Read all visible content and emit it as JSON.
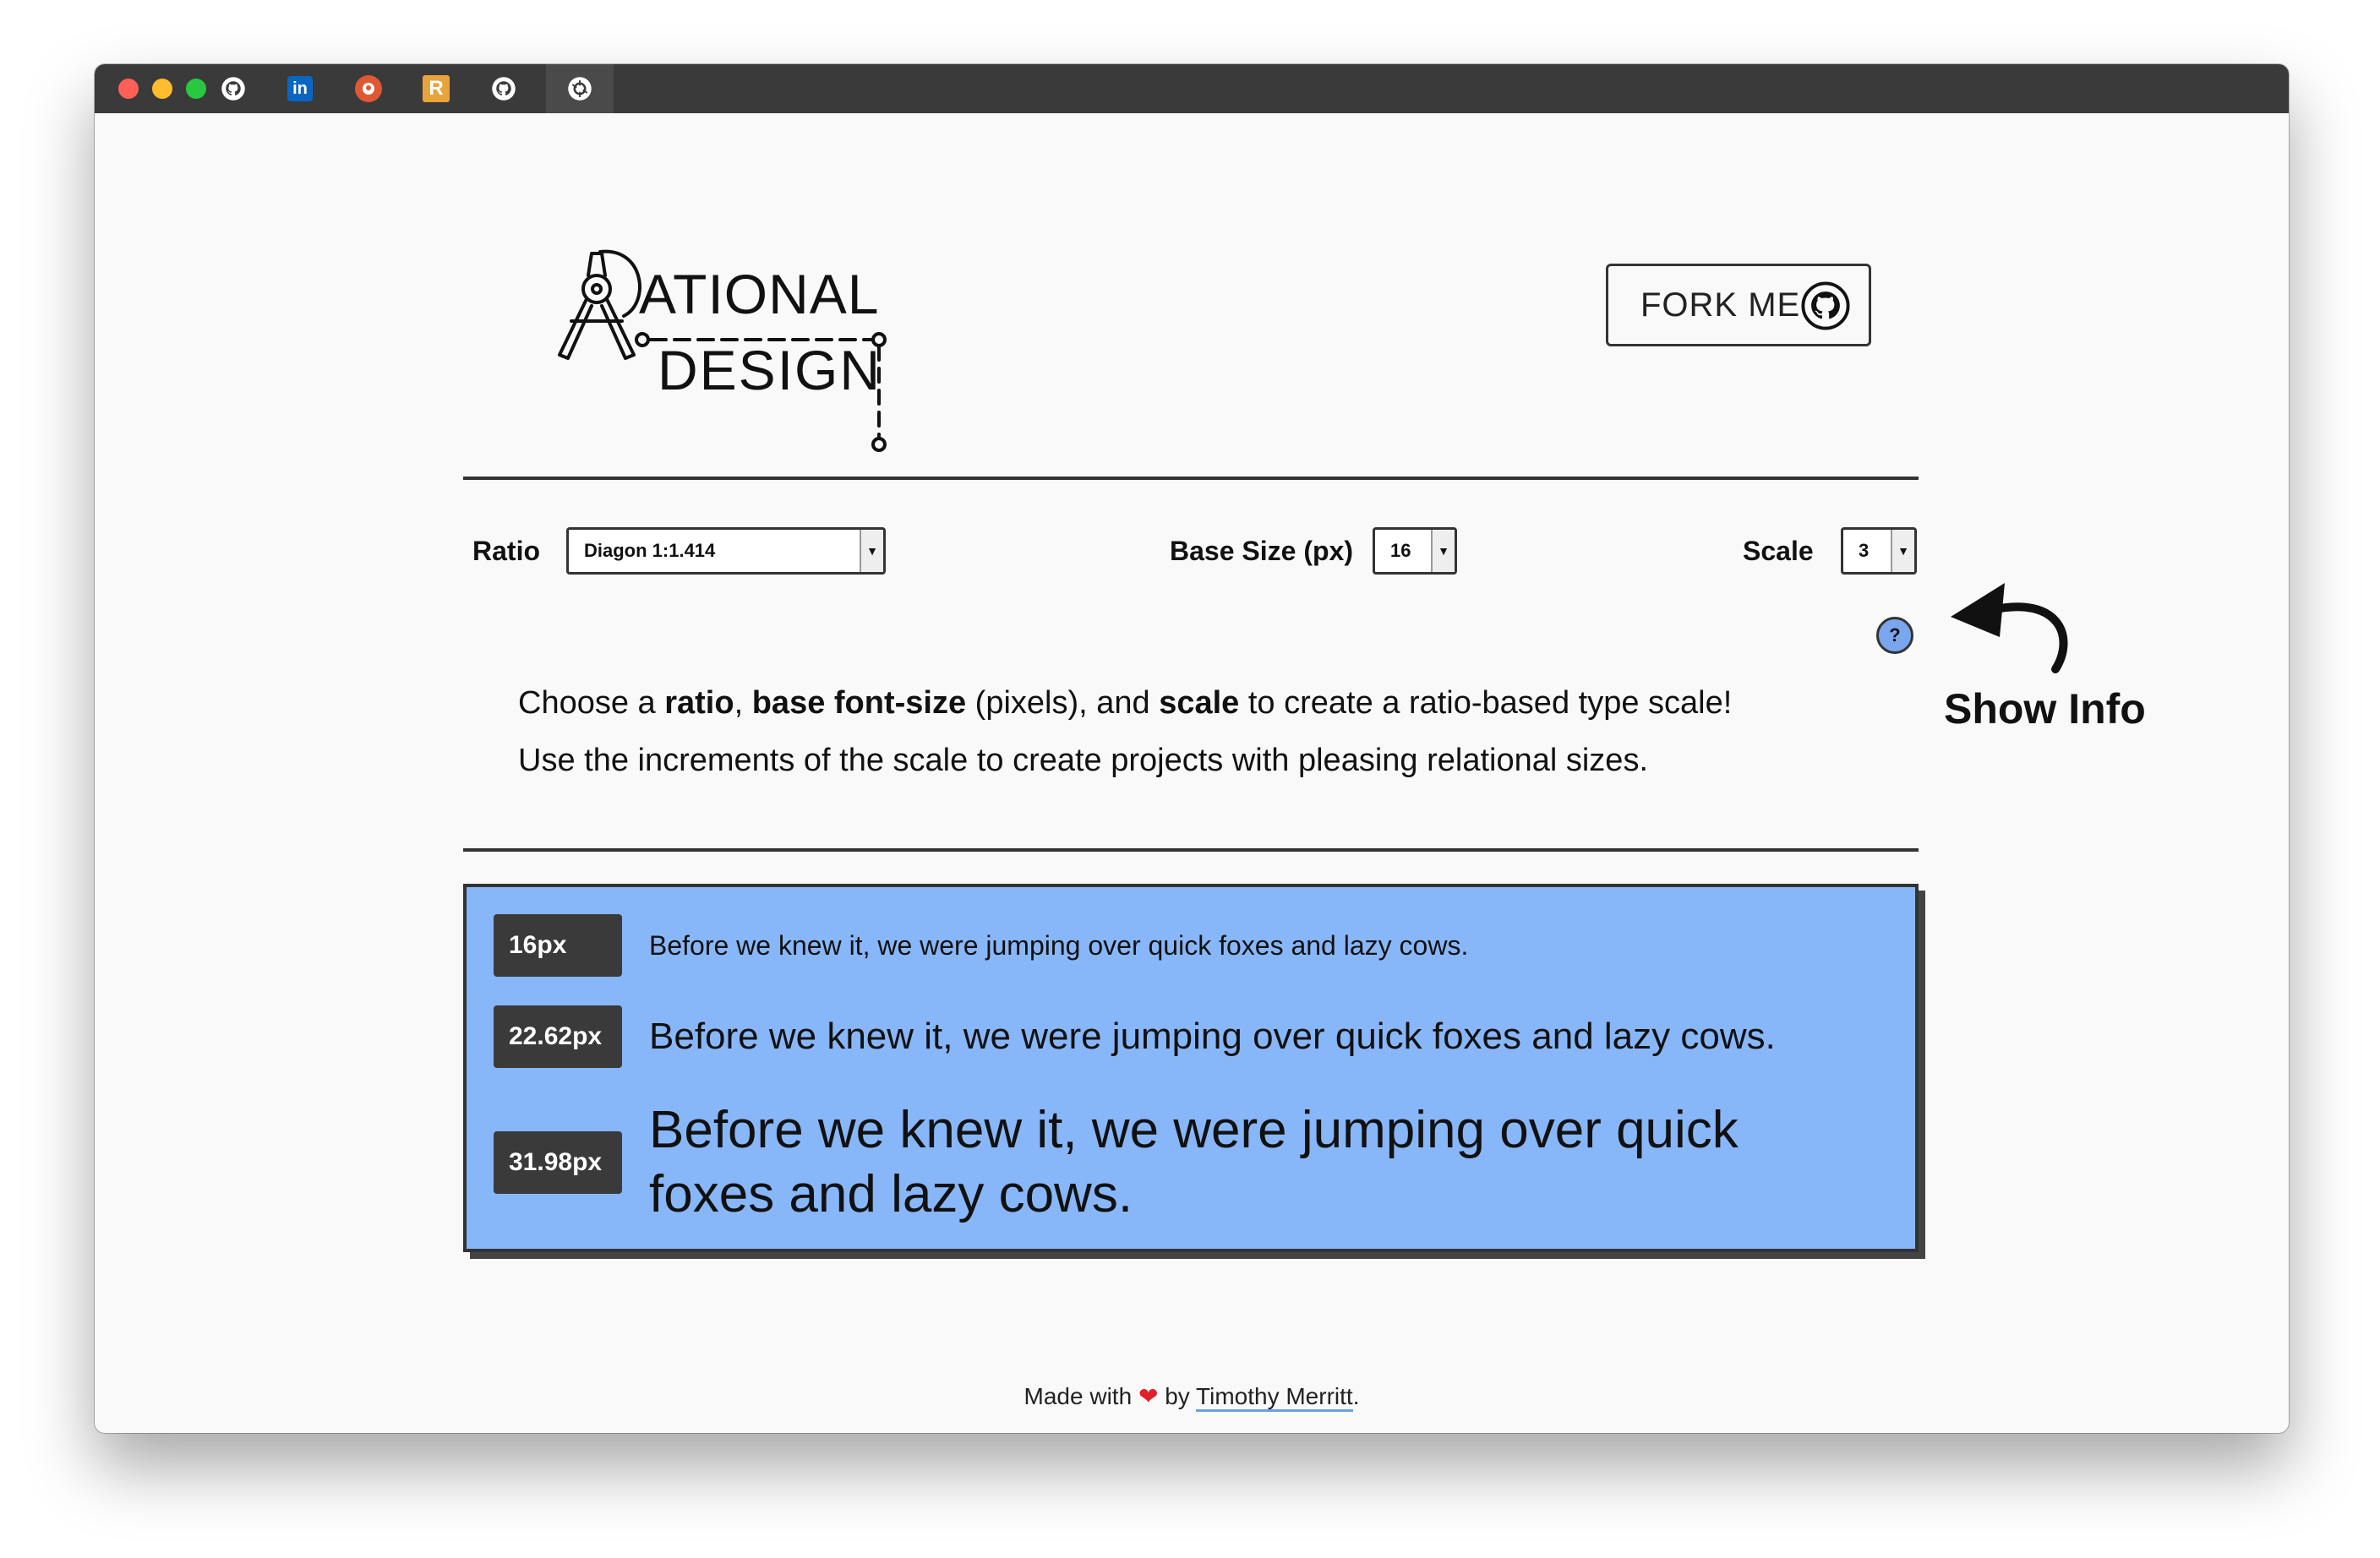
{
  "browser": {
    "tab_icons": [
      "github-icon",
      "linkedin-icon",
      "duckduckgo-icon",
      "r-icon",
      "github-icon",
      "openai-icon"
    ]
  },
  "header": {
    "logo_line1": "ATIONAL",
    "logo_line2": "DESIGN",
    "fork_label": "FORK ME"
  },
  "controls": {
    "ratio_label": "Ratio",
    "ratio_value": "Diagon 1:1.414",
    "base_label": "Base Size (px)",
    "base_value": "16",
    "scale_label": "Scale",
    "scale_value": "3",
    "help_glyph": "?",
    "show_info": "Show Info"
  },
  "description": {
    "l1_a": "Choose a ",
    "l1_ratio": "ratio",
    "l1_sep": ", ",
    "l1_base": "base font-size",
    "l1_b": " (pixels), and ",
    "l1_scale": "scale",
    "l1_c": " to create a ratio-based type scale!",
    "l2": "Use the increments of the scale to create projects with pleasing relational sizes."
  },
  "scale_rows": [
    {
      "size": "16px",
      "text": "Before we knew it, we were jumping over quick foxes and lazy cows."
    },
    {
      "size": "22.62px",
      "text": "Before we knew it, we were jumping over quick foxes and lazy cows."
    },
    {
      "size": "31.98px",
      "text": "Before we knew it, we were jumping over quick foxes and lazy cows."
    }
  ],
  "footer": {
    "made_with": "Made with",
    "heart": "❤",
    "by": "by",
    "author": "Timothy Merritt",
    "period": "."
  },
  "colors": {
    "titlebar": "#3a3a3a",
    "panel": "#88b7f9",
    "badge": "#3a3a3a",
    "help": "#7aa6ee"
  }
}
